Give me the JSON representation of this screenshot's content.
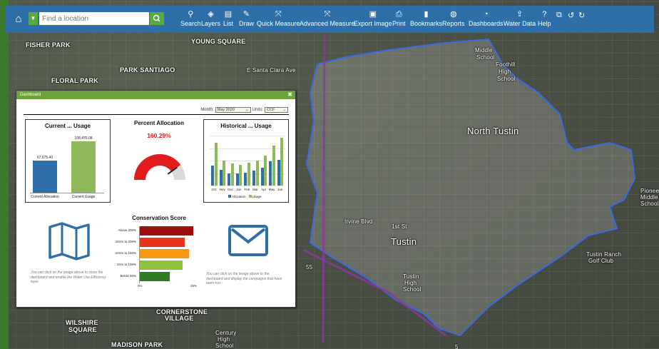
{
  "toolbar": {
    "search_placeholder": "Find a location",
    "tools": [
      {
        "id": "search",
        "label": "Search",
        "icon": "search-icon"
      },
      {
        "id": "layers",
        "label": "Layers",
        "icon": "layers-icon"
      },
      {
        "id": "list",
        "label": "List",
        "icon": "list-icon"
      },
      {
        "id": "draw",
        "label": "Draw",
        "icon": "pencil-icon"
      },
      {
        "id": "quick-measure",
        "label": "Quick Measure",
        "icon": "measure-icon"
      },
      {
        "id": "advanced-measure",
        "label": "Advanced Measure",
        "icon": "measure-icon"
      },
      {
        "id": "export-image",
        "label": "Export Image",
        "icon": "image-icon"
      },
      {
        "id": "print",
        "label": "Print",
        "icon": "print-icon"
      },
      {
        "id": "bookmarks",
        "label": "Bookmarks",
        "icon": "bookmark-icon"
      },
      {
        "id": "reports",
        "label": "Reports",
        "icon": "lightbulb-icon"
      },
      {
        "id": "dashboards",
        "label": "Dashboards",
        "icon": "dashboard-gauge-icon"
      },
      {
        "id": "water-data",
        "label": "Water Data",
        "icon": "upload-icon"
      },
      {
        "id": "help",
        "label": "Help",
        "icon": "question-icon"
      }
    ]
  },
  "map": {
    "labels": [
      {
        "text": "FISHER PARK",
        "cls": ""
      },
      {
        "text": "YOUNG SQUARE",
        "cls": ""
      },
      {
        "text": "PARK SANTIAGO",
        "cls": ""
      },
      {
        "text": "E Santa Clara Ave",
        "cls": "small"
      },
      {
        "text": "FLORAL PARK",
        "cls": ""
      },
      {
        "text": "Foothill",
        "cls": "small"
      },
      {
        "text": "High",
        "cls": "small"
      },
      {
        "text": "School",
        "cls": "small"
      },
      {
        "text": "Middle",
        "cls": "small"
      },
      {
        "text": "School",
        "cls": "small"
      },
      {
        "text": "North Tustin",
        "cls": "big"
      },
      {
        "text": "Irvine Blvd",
        "cls": "small"
      },
      {
        "text": "1st St",
        "cls": "small"
      },
      {
        "text": "Tustin",
        "cls": "big"
      },
      {
        "text": "Tustin",
        "cls": "small"
      },
      {
        "text": "High",
        "cls": "small"
      },
      {
        "text": "School",
        "cls": "small"
      },
      {
        "text": "Pioneer",
        "cls": "small"
      },
      {
        "text": "Middle",
        "cls": "small"
      },
      {
        "text": "School",
        "cls": "small"
      },
      {
        "text": "Tustin Ranch",
        "cls": "small"
      },
      {
        "text": "Golf Club",
        "cls": "small"
      },
      {
        "text": "CORNERSTONE",
        "cls": ""
      },
      {
        "text": "VILLAGE",
        "cls": ""
      },
      {
        "text": "Century",
        "cls": "small"
      },
      {
        "text": "High",
        "cls": "small"
      },
      {
        "text": "School",
        "cls": "small"
      },
      {
        "text": "WILSHIRE",
        "cls": ""
      },
      {
        "text": "SQUARE",
        "cls": ""
      },
      {
        "text": "MADISON PARK",
        "cls": ""
      },
      {
        "text": "55",
        "cls": "small"
      },
      {
        "text": "5",
        "cls": "small"
      }
    ]
  },
  "dashboard": {
    "title": "Dashboard",
    "month_label": "Month:",
    "month_value": "May 2020",
    "units_label": "Units:",
    "units_value": "CCF",
    "current_usage": {
      "title": "Current ... Usage",
      "chart_data": {
        "type": "bar",
        "categories": [
          "Current Allocation",
          "Current Usage"
        ],
        "values": [
          67675.4,
          108476.08
        ],
        "value_labels": [
          "67,675.40",
          "108,476.08"
        ],
        "ylim": [
          0,
          120000
        ],
        "colors": [
          "#2f6fa7",
          "#8fb85a"
        ]
      }
    },
    "percent_allocation": {
      "title": "Percent Allocation",
      "value_text": "160.29%",
      "value": 160.29,
      "gauge_max": 200
    },
    "historical_usage": {
      "title": "Historical ... Usage",
      "chart_data": {
        "type": "bar",
        "categories": [
          "Oct",
          "Nov",
          "Dec",
          "Jan",
          "Feb",
          "Mar",
          "Apr",
          "May",
          "Jun"
        ],
        "series": [
          {
            "name": "Allocation",
            "color": "#2f6fa7",
            "values": [
              40,
              32,
              24,
              24,
              26,
              30,
              36,
              48,
              52
            ]
          },
          {
            "name": "Usage",
            "color": "#8fb85a",
            "values": [
              86,
              50,
              44,
              42,
              46,
              50,
              60,
              80,
              96
            ]
          }
        ],
        "ylim": [
          0,
          100
        ],
        "grid": true
      }
    },
    "map_card": {
      "icon": "map-icon",
      "text": "You can click on the image above to close the dashboard and enable the Water Use Efficiency layer."
    },
    "conservation_score": {
      "title": "Conservation Score",
      "chart_data": {
        "type": "bar",
        "orientation": "horizontal",
        "categories": [
          "Above 200%",
          "151% to 200%",
          "101% to 150%",
          "51% to 100%",
          "Below 50%"
        ],
        "values": [
          25,
          21,
          23,
          20,
          14
        ],
        "colors": [
          "#9b0f0f",
          "#e8341a",
          "#f59a12",
          "#8fc23a",
          "#2e7d23"
        ],
        "xlim": [
          0,
          25
        ],
        "x_ticks": [
          "0%",
          "25%"
        ]
      }
    },
    "mail_card": {
      "icon": "mail-icon",
      "text": "You can click on the image above to the dashboard and display the campaigns that have been run."
    }
  }
}
